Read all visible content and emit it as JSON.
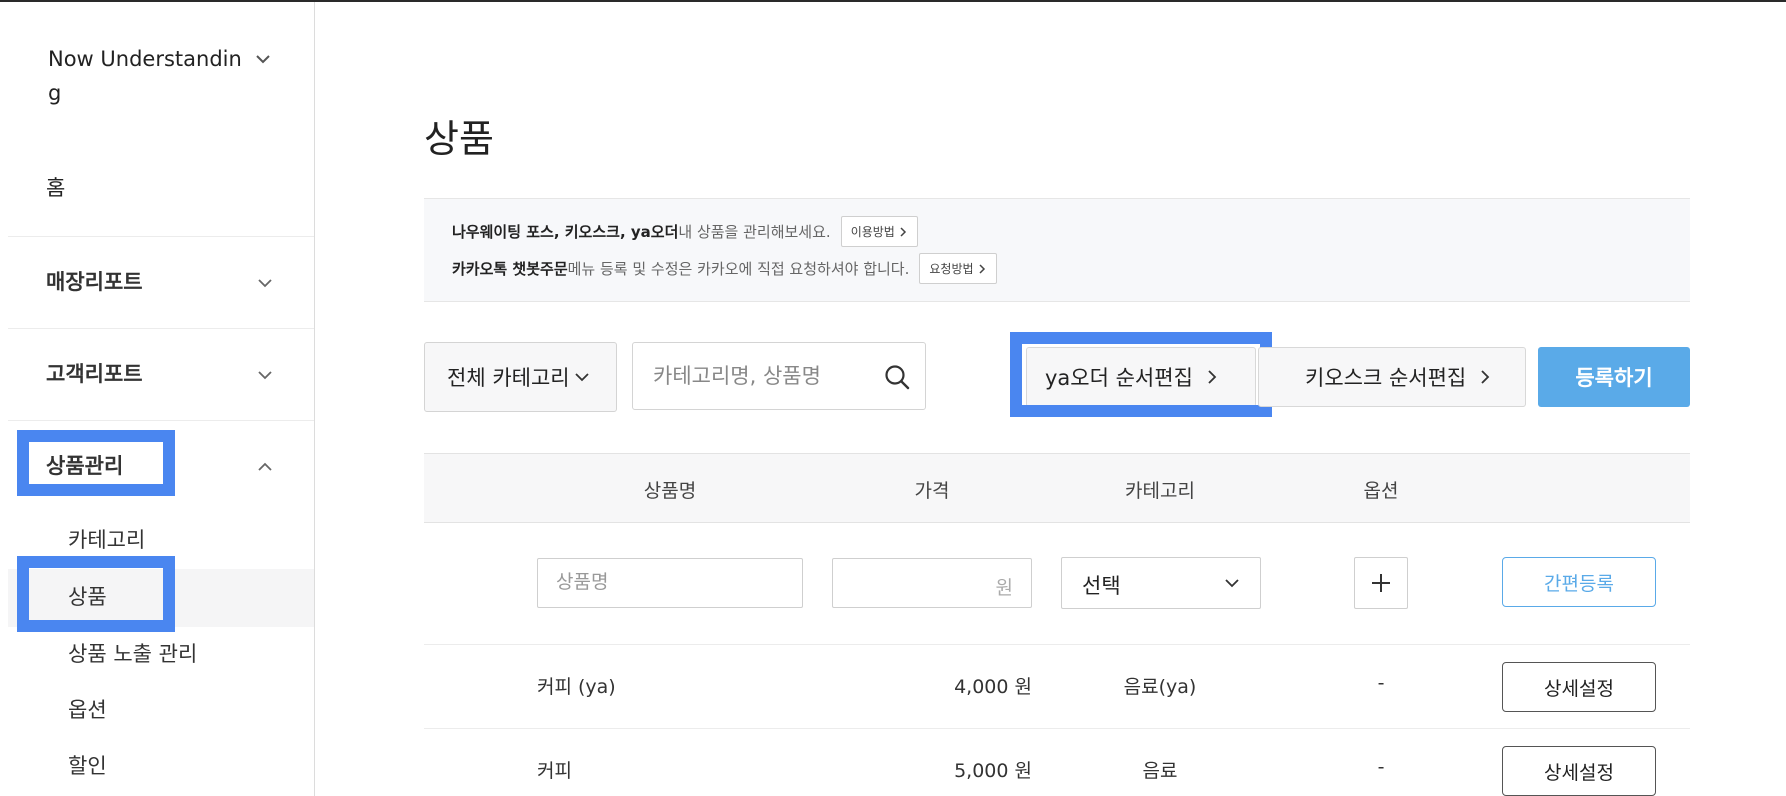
{
  "sidebar": {
    "store_name": "Now Understanding",
    "home": "홈",
    "sections": [
      {
        "label": "매장리포트"
      },
      {
        "label": "고객리포트"
      },
      {
        "label": "상품관리"
      }
    ],
    "product_menu": [
      {
        "label": "카테고리"
      },
      {
        "label": "상품"
      },
      {
        "label": "상품 노출 관리"
      },
      {
        "label": "옵션"
      },
      {
        "label": "할인"
      }
    ]
  },
  "page": {
    "title": "상품"
  },
  "notice": {
    "line1_bold": "나우웨이팅 포스, 키오스크, ya오더",
    "line1_text": " 내 상품을 관리해보세요.",
    "line1_button": "이용방법",
    "line2_bold": "카카오톡 챗봇주문",
    "line2_text": " 메뉴 등록 및 수정은 카카오에 직접 요청하셔야 합니다.",
    "line2_button": "요청방법"
  },
  "toolbar": {
    "category_select": "전체 카테고리",
    "search_placeholder": "카테고리명, 상품명",
    "ya_order_edit": "ya오더 순서편집",
    "kiosk_order_edit": "키오스크 순서편집",
    "register": "등록하기"
  },
  "table": {
    "headers": {
      "name": "상품명",
      "price": "가격",
      "category": "카테고리",
      "option": "옵션"
    },
    "quick_add": {
      "name_placeholder": "상품명",
      "price_unit": "원",
      "category_select": "선택",
      "quick_register": "간편등록"
    },
    "rows": [
      {
        "name": "커피 (ya)",
        "price": "4,000 원",
        "category": "음료(ya)",
        "option": "-",
        "action": "상세설정"
      },
      {
        "name": "커피",
        "price": "5,000 원",
        "category": "음료",
        "option": "-",
        "action": "상세설정"
      }
    ]
  },
  "colors": {
    "accent_blue": "#5aaae8",
    "highlight_blue": "#4a86f0"
  }
}
